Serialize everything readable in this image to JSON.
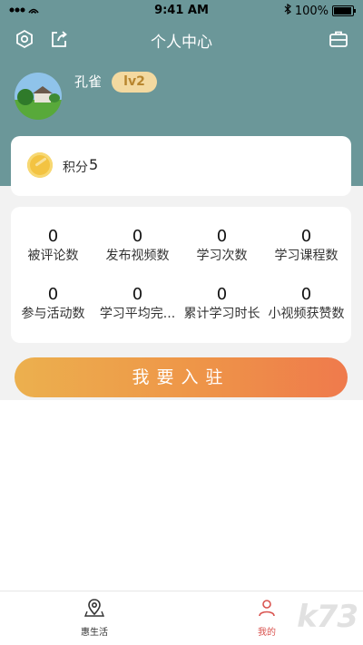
{
  "status_bar": {
    "carrier": "•••",
    "time": "9:41 AM",
    "battery": "100%",
    "battery_level": 1.0
  },
  "header": {
    "title": "个人中心",
    "left_icons": [
      "settings-icon",
      "share-icon"
    ],
    "right_icon": "briefcase-icon"
  },
  "profile": {
    "name": "孔雀",
    "level": "lv2"
  },
  "points": {
    "label": "积分",
    "value": "5"
  },
  "stats": [
    {
      "value": "0",
      "label": "被评论数"
    },
    {
      "value": "0",
      "label": "发布视频数"
    },
    {
      "value": "0",
      "label": "学习次数"
    },
    {
      "value": "0",
      "label": "学习课程数"
    },
    {
      "value": "0",
      "label": "参与活动数"
    },
    {
      "value": "0",
      "label": "学习平均完..."
    },
    {
      "value": "0",
      "label": "累计学习时长"
    },
    {
      "value": "0",
      "label": "小视频获赞数"
    }
  ],
  "join_button": "我要入驻",
  "tabbar": {
    "items": [
      {
        "label": "惠生活",
        "icon": "map-pin-icon"
      },
      {
        "label": "我的",
        "icon": "user-icon"
      }
    ]
  },
  "watermark": "k73",
  "colors": {
    "header_bg": "#6b9799",
    "badge_bg": "#f3d9a0",
    "button_start": "#ecb04e",
    "button_end": "#ef7a4c"
  }
}
